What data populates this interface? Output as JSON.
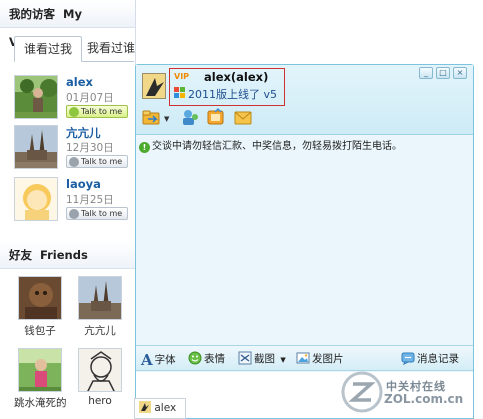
{
  "visitors_panel": {
    "title_cn": "我的访客",
    "title_en": "My Visitors",
    "tabs": [
      {
        "label": "谁看过我"
      },
      {
        "label": "我看过谁"
      }
    ],
    "visitors": [
      {
        "name": "alex",
        "date": "01月07日",
        "talk_label": "Talk to me"
      },
      {
        "name": "亢亢儿",
        "date": "12月30日",
        "talk_label": "Talk to me"
      },
      {
        "name": "laoya",
        "date": "11月25日",
        "talk_label": "Talk to me"
      }
    ]
  },
  "friends_panel": {
    "title_cn": "好友",
    "title_en": "Friends",
    "friends": [
      {
        "name": "钱包子"
      },
      {
        "name": "亢亢儿"
      },
      {
        "name": "跳水淹死的"
      },
      {
        "name": "hero"
      }
    ]
  },
  "chat_window": {
    "vip_badge": "VIP",
    "contact_name": "alex(alex)",
    "status": "2011版上线了 v5",
    "notice": "交谈中请勿轻信汇款、中奖信息，勿轻易拨打陌生电话。",
    "toolbar": {
      "font_label": "字体",
      "emoji_label": "表情",
      "screenshot_label": "截图",
      "send_image_label": "发图片",
      "history_label": "消息记录"
    },
    "window_buttons": [
      "_",
      "□",
      "×"
    ]
  },
  "bottom_tab": {
    "label": "alex"
  },
  "watermark": {
    "cn": "中关村在线",
    "en": "ZOL.com.cn"
  },
  "colors": {
    "chat_bg": "#eaf6fb",
    "chat_border": "#7cc3dd",
    "highlight_box": "#cf3030",
    "link_blue": "#1b5ea3"
  }
}
